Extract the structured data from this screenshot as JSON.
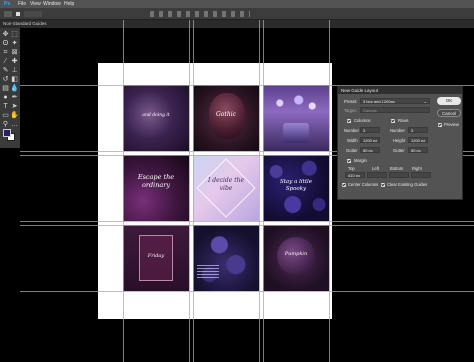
{
  "menubar": {
    "app_icon": "Ps",
    "items": [
      "File",
      "View",
      "Window",
      "Help"
    ]
  },
  "document_tab": {
    "label": "Non-Standard Guides"
  },
  "dialog": {
    "title": "New Guide Layout",
    "preset_label": "Preset:",
    "preset_value": "3 box grid 1200px",
    "target_label": "Target:",
    "target_value": "Canvas",
    "columns_label": "Columns",
    "rows_label": "Rows",
    "col_number_label": "Number",
    "col_number_value": "3",
    "col_width_label": "Width",
    "col_width_value": "1200 px",
    "col_gutter_label": "Gutter",
    "col_gutter_value": "50 px",
    "row_number_label": "Number",
    "row_number_value": "3",
    "row_height_label": "Height",
    "row_height_value": "1200 px",
    "row_gutter_label": "Gutter",
    "row_gutter_value": "50 px",
    "margin_label": "Margin",
    "margin_top_label": "Top",
    "margin_top_value": "410 px",
    "margin_left_label": "Left",
    "margin_bottom_label": "Bottom",
    "margin_right_label": "Right",
    "center_columns_label": "Center Columns",
    "clear_guides_label": "Clear Existing Guides",
    "ok_label": "OK",
    "cancel_label": "Cancel",
    "preview_label": "Preview"
  },
  "tiles": {
    "t1": "and doing it",
    "t2": "Gothic",
    "t3": "Escape the ordinary",
    "t4": "I decide the vibe",
    "t5": "Stay a little Spooky",
    "t6": "Friday",
    "t7": "Pumpkin"
  },
  "colors": {
    "accent": "#2d7fd3",
    "guide": "#57c9d6",
    "dialog_bg": "#535353",
    "ui_dark": "#3a3a3a"
  }
}
